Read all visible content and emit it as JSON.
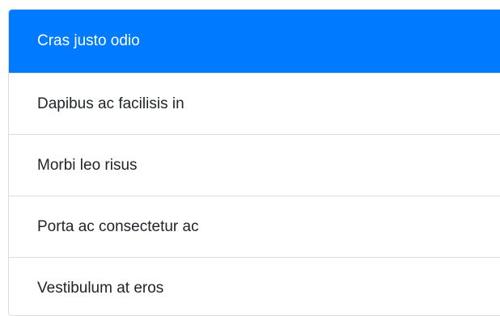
{
  "list": {
    "items": [
      {
        "label": "Cras justo odio",
        "active": true
      },
      {
        "label": "Dapibus ac facilisis in",
        "active": false
      },
      {
        "label": "Morbi leo risus",
        "active": false
      },
      {
        "label": "Porta ac consectetur ac",
        "active": false
      },
      {
        "label": "Vestibulum at eros",
        "active": false
      }
    ]
  },
  "colors": {
    "active_bg": "#007bff",
    "active_text": "#ffffff",
    "text": "#212529",
    "border": "#dcdcdc"
  }
}
